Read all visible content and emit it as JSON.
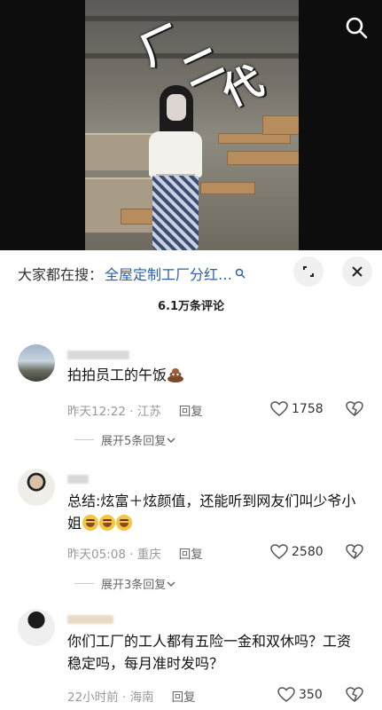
{
  "video": {
    "overlay_chars": [
      "厂",
      "二",
      "代"
    ]
  },
  "search_bar": {
    "prefix": "大家都在搜：",
    "term": "全屋定制工厂分红…"
  },
  "comment_count": "6.1万条评论",
  "comments": [
    {
      "text": "拍拍员工的午饭",
      "time": "昨天12:22",
      "location": "江苏",
      "reply": "回复",
      "likes": "1758",
      "expand": "展开5条回复"
    },
    {
      "text": "总结:炫富＋炫颜值，还能听到网友们叫少爷小姐",
      "time": "昨天05:08",
      "location": "重庆",
      "reply": "回复",
      "likes": "2580",
      "expand": "展开3条回复"
    },
    {
      "text": "你们工厂的工人都有五险一金和双休吗？工资稳定吗，每月准时发吗？",
      "time": "22小时前",
      "location": "海南",
      "reply": "回复",
      "likes": "350"
    }
  ],
  "colors": {
    "link": "#2b5fa6",
    "meta": "#999999"
  },
  "icons": [
    "search-icon",
    "expand-icon",
    "close-icon",
    "heart-icon",
    "dislike-icon",
    "chevron-down-icon"
  ]
}
